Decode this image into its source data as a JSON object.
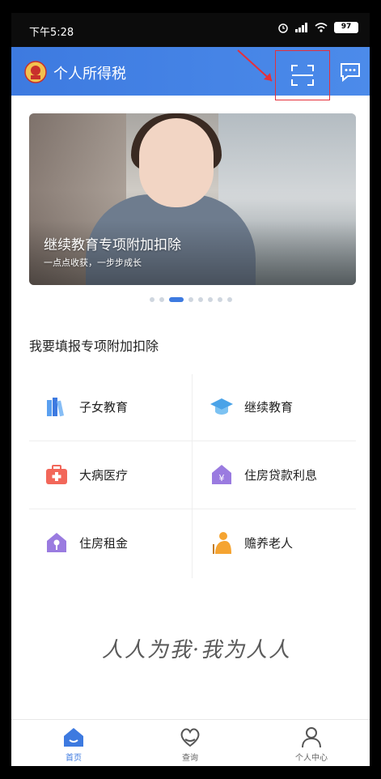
{
  "status_bar": {
    "time": "下午5:28",
    "battery": "97"
  },
  "header": {
    "title": "个人所得税"
  },
  "banner": {
    "title": "继续教育专项附加扣除",
    "subtitle": "一点点收获，一步步成长",
    "dot_count": 8,
    "active_dot": 2
  },
  "section": {
    "title": "我要填报专项附加扣除"
  },
  "deductions": [
    {
      "label": "子女教育",
      "icon": "books-icon"
    },
    {
      "label": "继续教育",
      "icon": "graduation-cap-icon"
    },
    {
      "label": "大病医疗",
      "icon": "medical-kit-icon"
    },
    {
      "label": "住房贷款利息",
      "icon": "house-loan-icon"
    },
    {
      "label": "住房租金",
      "icon": "rent-key-icon"
    },
    {
      "label": "赡养老人",
      "icon": "elderly-icon"
    }
  ],
  "slogan": "人人为我·我为人人",
  "tabs": [
    {
      "label": "首页",
      "icon": "home-icon",
      "active": true
    },
    {
      "label": "查询",
      "icon": "heart-search-icon",
      "active": false
    },
    {
      "label": "个人中心",
      "icon": "person-icon",
      "active": false
    }
  ],
  "colors": {
    "primary": "#3d7ae0",
    "highlight_box": "#e5303a"
  }
}
